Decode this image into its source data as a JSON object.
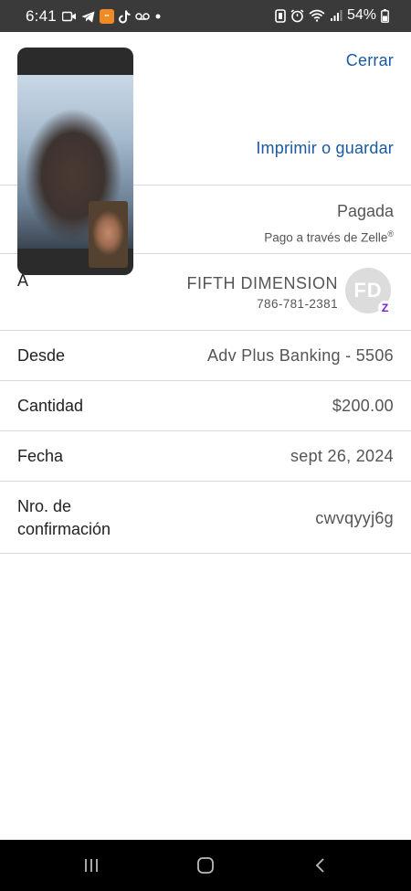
{
  "status_bar": {
    "time": "6:41",
    "battery_percent": "54%",
    "icons_left": [
      "video-call-icon",
      "telegram-icon",
      "app-badge-icon",
      "tiktok-icon",
      "voicemail-icon",
      "dot-icon"
    ],
    "icons_right": [
      "nfc-icon",
      "alarm-icon",
      "wifi-icon",
      "signal-icon",
      "battery-icon"
    ]
  },
  "header": {
    "close_label": "Cerrar",
    "print_label": "Imprimir o guardar"
  },
  "payment_status": {
    "status": "Pagada",
    "method": "Pago a través de Zelle",
    "method_mark": "®"
  },
  "recipient": {
    "label": "A",
    "name": "FIFTH DIMENSION",
    "phone": "786-781-2381",
    "initials": "FD",
    "badge": "Z",
    "avatar_color": "#dcdcdc",
    "badge_color": "#6d1ed4"
  },
  "details": [
    {
      "label": "Desde",
      "value": "Adv Plus Banking - 5506"
    },
    {
      "label": "Cantidad",
      "value": "$200.00"
    },
    {
      "label": "Fecha",
      "value": "sept 26, 2024"
    },
    {
      "label_line1": "Nro. de",
      "label_line2": "confirmación",
      "value": "cwvqyyj6g"
    }
  ],
  "colors": {
    "link": "#1a5aa2",
    "status_bar": "#3a3a3a",
    "nav_bar": "#000000"
  },
  "nav": [
    "recent-apps-icon",
    "home-icon",
    "back-icon"
  ]
}
